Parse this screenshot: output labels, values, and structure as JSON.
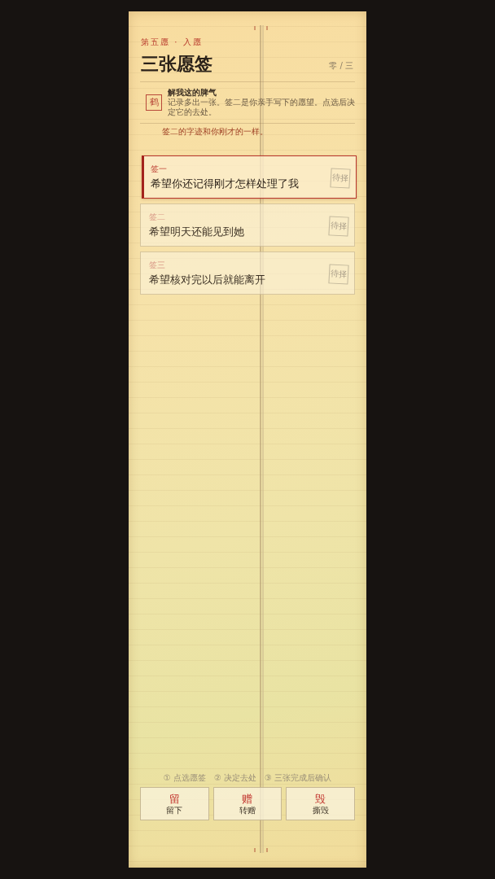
{
  "header": {
    "chapter": "第五愿 · 入愿",
    "title": "三张愿签",
    "progress": "零 / 三"
  },
  "note": {
    "seal": "鹤",
    "title": "解我这的脾气",
    "body": "记录多出一张。签二是你亲手写下的愿望。点选后决定它的去处。",
    "remark": "签二的字迹和你刚才的一样。"
  },
  "slips": [
    {
      "label": "签一",
      "text": "希望你还记得刚才怎样处理了我",
      "stamp": "待择",
      "selected": true
    },
    {
      "label": "签二",
      "text": "希望明天还能见到她",
      "stamp": "待择",
      "selected": false
    },
    {
      "label": "签三",
      "text": "希望核对完以后就能离开",
      "stamp": "待择",
      "selected": false
    }
  ],
  "steps": [
    "① 点选愿签",
    "② 决定去处",
    "③ 三张完成后确认"
  ],
  "actions": [
    {
      "glyph": "留",
      "label": "留下"
    },
    {
      "glyph": "赠",
      "label": "转赠"
    },
    {
      "glyph": "毁",
      "label": "撕毁"
    }
  ]
}
